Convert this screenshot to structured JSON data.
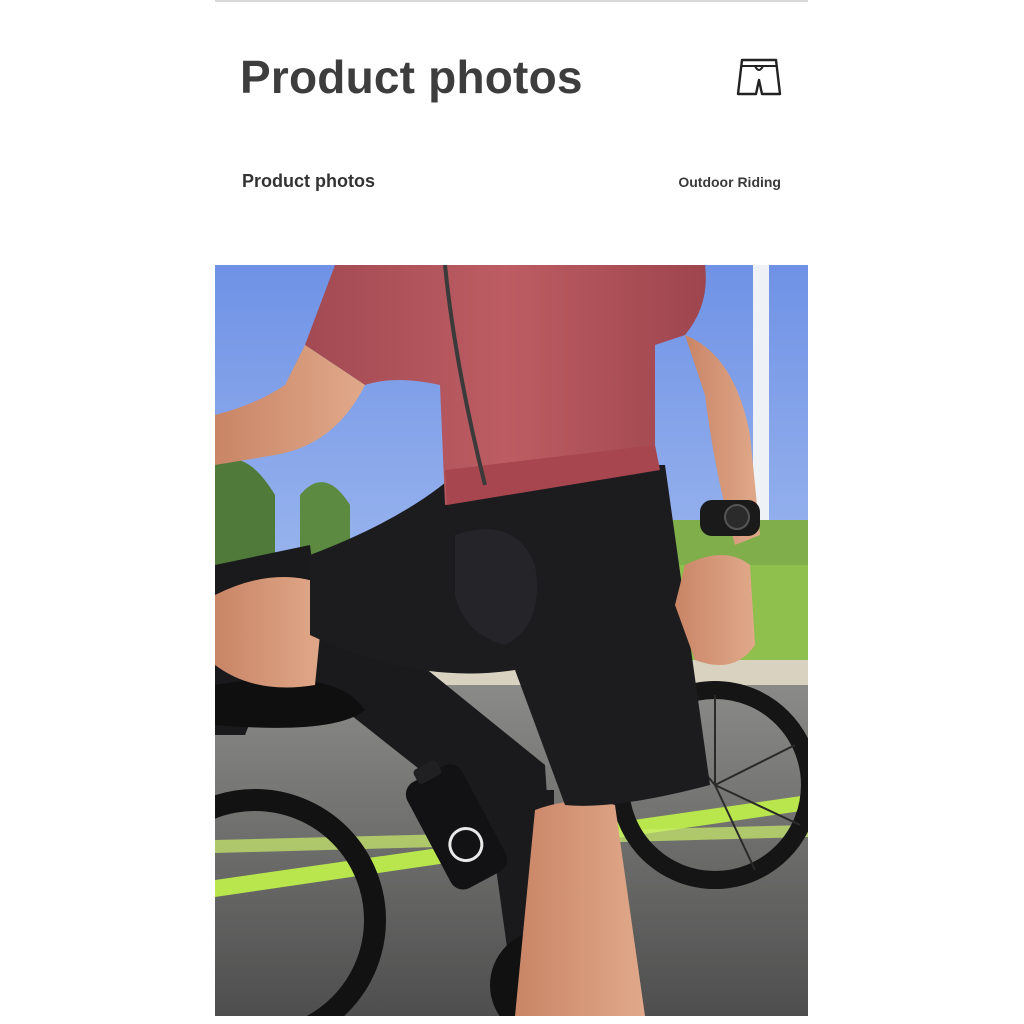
{
  "header": {
    "title": "Product photos",
    "icon": "shorts-icon"
  },
  "section": {
    "subtitle": "Product photos",
    "tag": "Outdoor Riding"
  },
  "photo": {
    "subject": "cyclist-on-road-bike",
    "colors": {
      "sky": "#7ea0e8",
      "jersey": "#b3535a",
      "shorts": "#1c1c1f",
      "skin": "#d79a7a",
      "road": "#6b6b6b",
      "lane_line": "#b8e64c",
      "grass": "#8fbf4d"
    }
  }
}
